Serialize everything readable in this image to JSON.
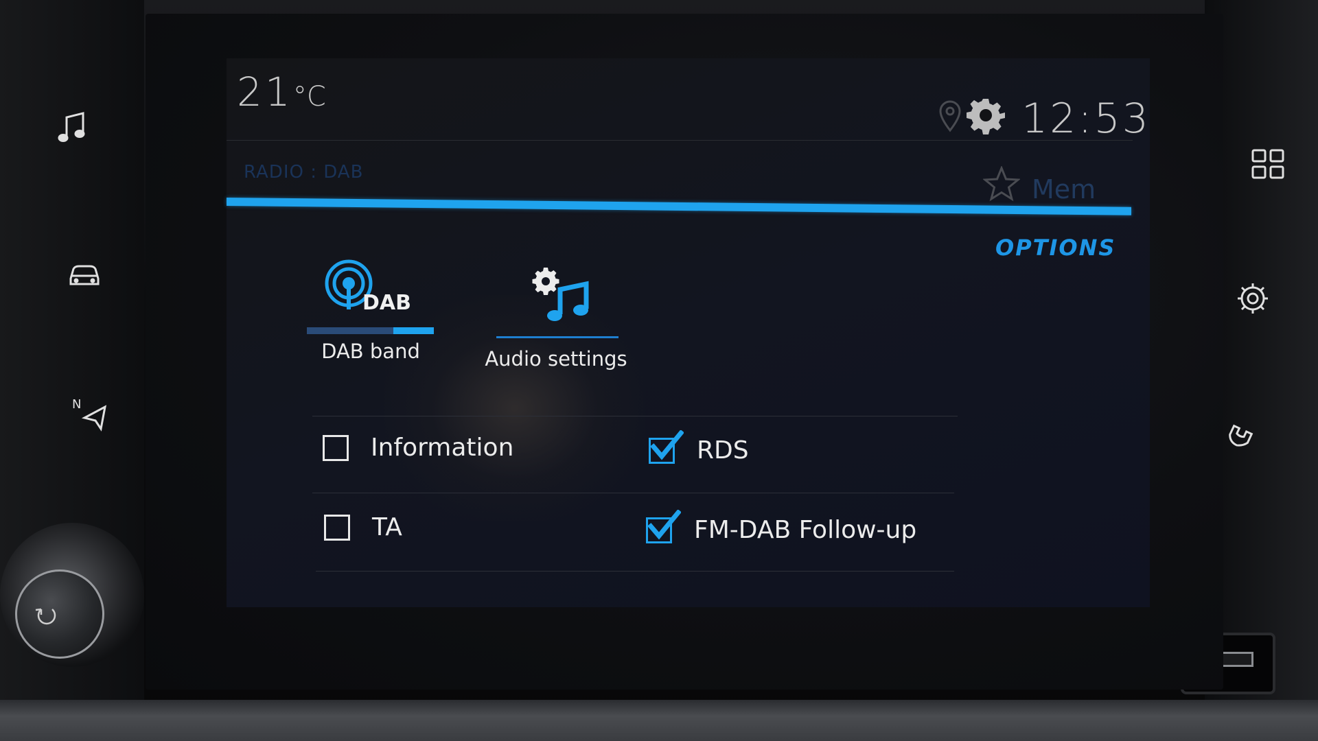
{
  "status_bar": {
    "temperature": "21",
    "temperature_unit": "°C",
    "time": "12:53"
  },
  "header": {
    "breadcrumb": "RADIO : DAB",
    "mem_label": "Mem",
    "section_title": "OPTIONS"
  },
  "tiles": [
    {
      "label": "DAB band",
      "icon": "dab-broadcast-icon",
      "badge": "DAB"
    },
    {
      "label": "Audio settings",
      "icon": "audio-settings-icon"
    }
  ],
  "options": {
    "information": {
      "label": "Information",
      "checked": false
    },
    "rds": {
      "label": "RDS",
      "checked": true
    },
    "ta": {
      "label": "TA",
      "checked": false
    },
    "fm_dab_followup": {
      "label": "FM-DAB Follow-up",
      "checked": true
    }
  },
  "side_buttons": {
    "left": [
      "music-note-icon",
      "car-icon",
      "navigation-icon"
    ],
    "right": [
      "apps-grid-icon",
      "settings-gear-icon",
      "phone-icon"
    ]
  },
  "colors": {
    "accent": "#1FA3EE",
    "text": "#ECECEC",
    "background": "#121520"
  }
}
